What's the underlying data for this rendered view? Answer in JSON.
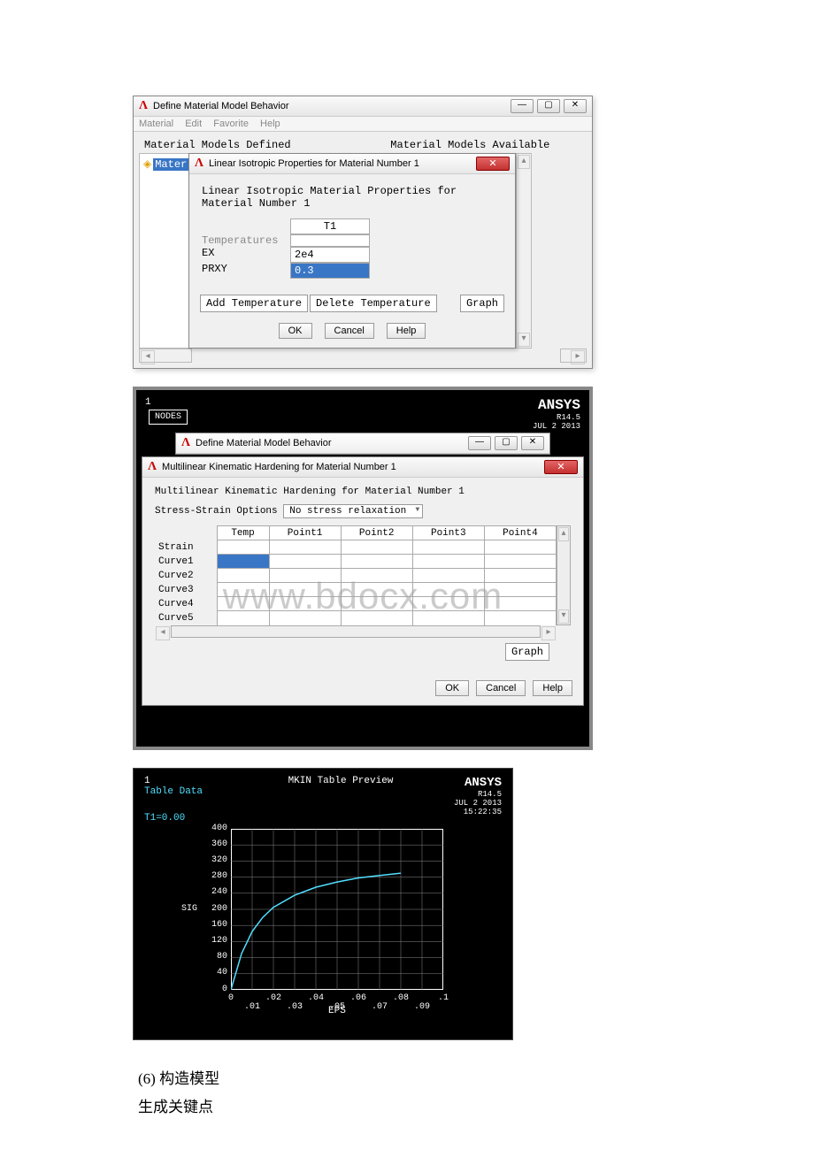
{
  "win1": {
    "title": "Define Material Model Behavior",
    "menu": [
      "Material",
      "Edit",
      "Favorite",
      "Help"
    ],
    "field_left": "Material Models Defined",
    "field_right": "Material Models Available",
    "tree_item": "Mater",
    "inner_title": "Linear Isotropic Properties for Material Number 1",
    "heading": "Linear Isotropic Material Properties for Material Number 1",
    "col_t1": "T1",
    "row_temp": "Temperatures",
    "row_ex": "EX",
    "row_prxy": "PRXY",
    "val_ex": "2e4",
    "val_prxy": "0.3",
    "add_temp": "Add Temperature",
    "del_temp": "Delete Temperature",
    "graph": "Graph",
    "ok": "OK",
    "cancel": "Cancel",
    "help": "Help"
  },
  "win2": {
    "one": "1",
    "nodes": "NODES",
    "logo": "ANSYS",
    "rev": "R14.5",
    "date": "JUL  2 2013",
    "inner1": "Define Material Model Behavior",
    "mkin_title": "Multilinear Kinematic Hardening for Material Number 1",
    "mkin_heading": "Multilinear Kinematic Hardening for Material Number 1",
    "ss_label": "Stress-Strain Options",
    "ss_value": "No stress relaxation",
    "cols": [
      "",
      "Temp",
      "Point1",
      "Point2",
      "Point3",
      "Point4"
    ],
    "rows": [
      "Strain",
      "Curve1",
      "Curve2",
      "Curve3",
      "Curve4",
      "Curve5"
    ],
    "graph": "Graph",
    "ok": "OK",
    "cancel": "Cancel",
    "help": "Help",
    "watermark": "www.bdocx.com"
  },
  "win3": {
    "one": "1",
    "table_data": "Table Data",
    "title": "MKIN Table Preview",
    "logo": "ANSYS",
    "rev": "R14.5",
    "date": "JUL  2 2013",
    "time": "15:22:35",
    "t1": "T1=0.00",
    "sig": "SIG",
    "eps": "EPS"
  },
  "doc": {
    "line1": "(6) 构造模型",
    "line2": "生成关键点"
  },
  "chart_data": {
    "type": "line",
    "title": "MKIN Table Preview",
    "xlabel": "EPS",
    "ylabel": "SIG",
    "xlim": [
      0,
      0.1
    ],
    "ylim": [
      0,
      400
    ],
    "xticks": [
      0,
      0.01,
      0.02,
      0.03,
      0.04,
      0.05,
      0.06,
      0.07,
      0.08,
      0.09,
      0.1
    ],
    "yticks": [
      0,
      40,
      80,
      120,
      160,
      200,
      240,
      280,
      320,
      360,
      400
    ],
    "x": [
      0,
      0.005,
      0.01,
      0.015,
      0.02,
      0.03,
      0.04,
      0.05,
      0.06,
      0.07,
      0.08
    ],
    "y": [
      0,
      90,
      145,
      180,
      205,
      235,
      255,
      268,
      278,
      284,
      290
    ],
    "grid": true,
    "color": "#52dfff"
  }
}
